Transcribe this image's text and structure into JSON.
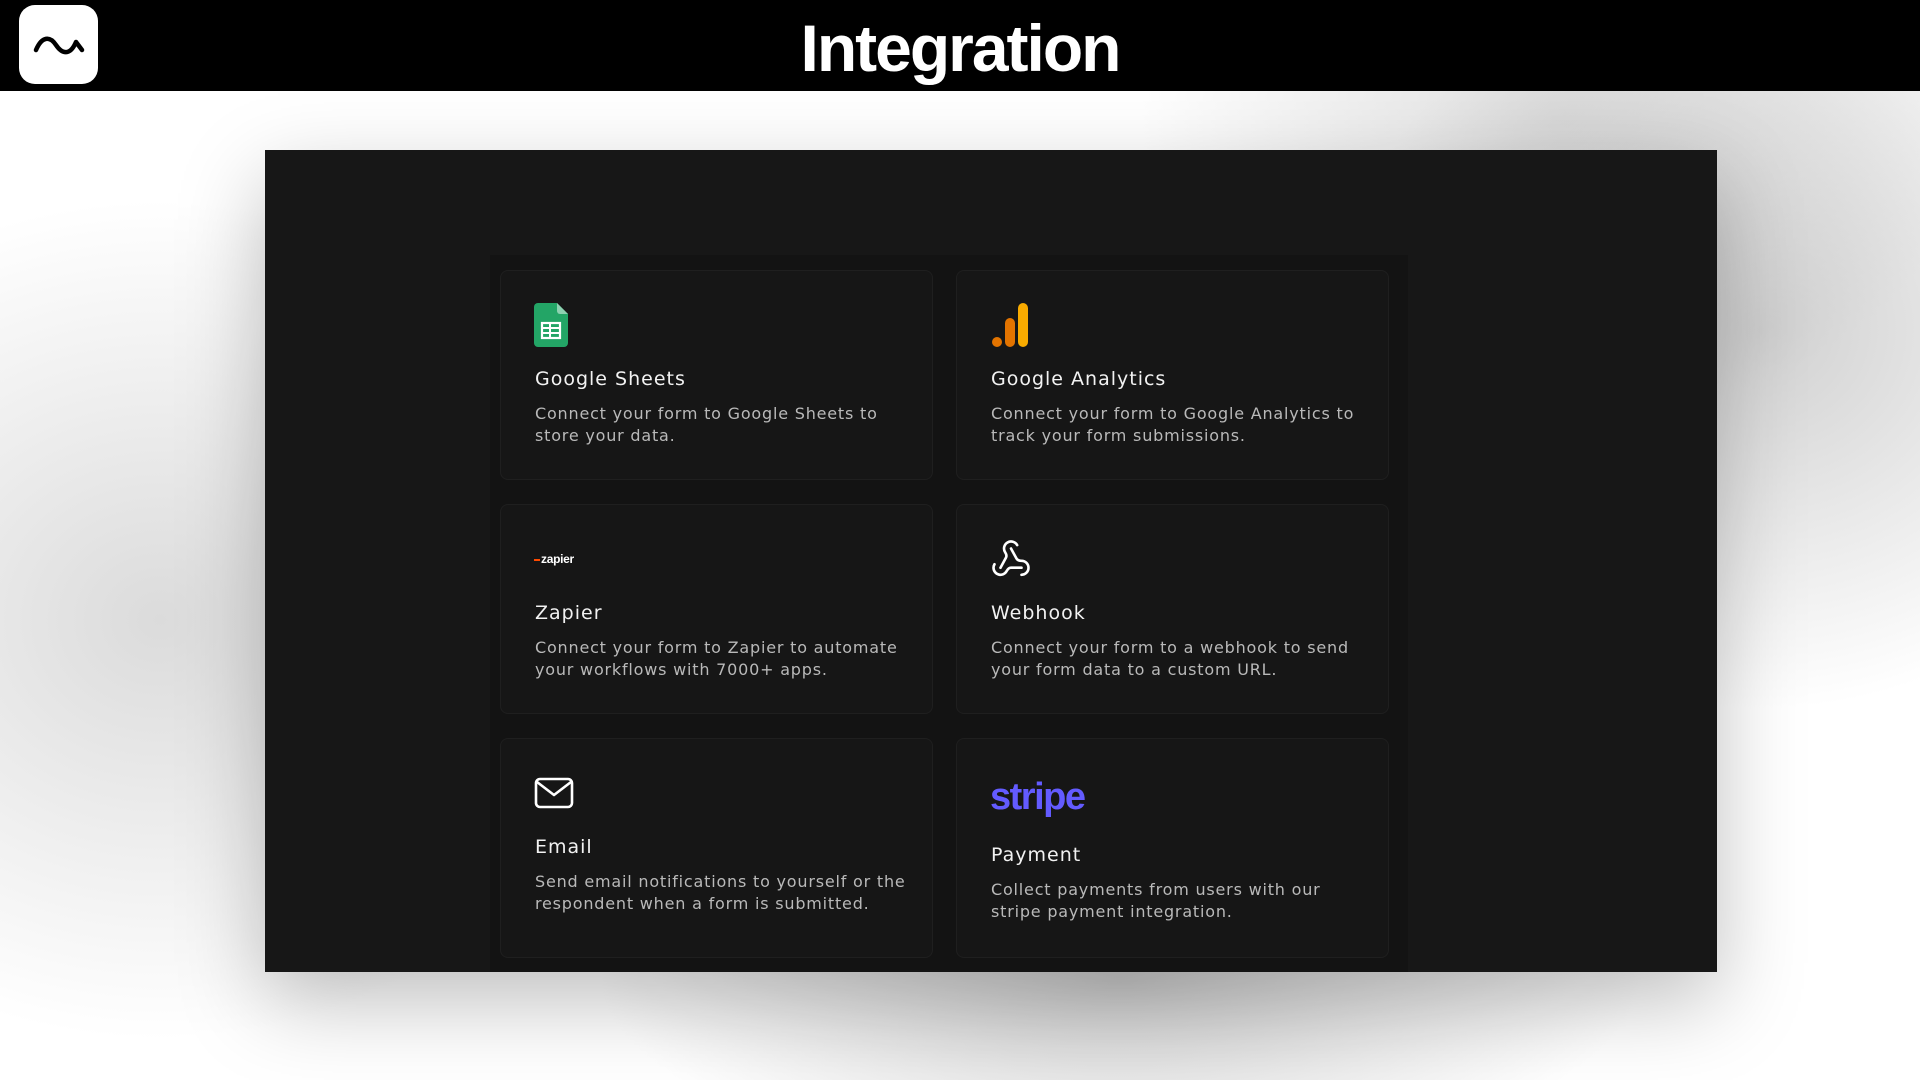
{
  "header": {
    "title": "Integration",
    "logo_icon": "wave-logo-icon"
  },
  "integrations": [
    {
      "title": "Google Sheets",
      "description": "Connect your form to Google Sheets to store your data.",
      "icon": "google-sheets-icon"
    },
    {
      "title": "Google Analytics",
      "description": "Connect your form to Google Analytics to track your form submissions.",
      "icon": "google-analytics-icon"
    },
    {
      "title": "Zapier",
      "description": "Connect your form to Zapier to automate your workflows with 7000+ apps.",
      "icon": "zapier-logo",
      "logo_text": "zapier"
    },
    {
      "title": "Webhook",
      "description": "Connect your form to a webhook to send your form data to a custom URL.",
      "icon": "webhook-icon"
    },
    {
      "title": "Email",
      "description": "Send email notifications to yourself or the respondent when a form is submitted.",
      "icon": "mail-icon"
    },
    {
      "title": "Payment",
      "description": "Collect payments from users with our stripe payment integration.",
      "icon": "stripe-logo",
      "logo_text": "stripe"
    }
  ],
  "colors": {
    "sheets_green": "#23a566",
    "analytics_orange": "#f9ab00",
    "analytics_dark_orange": "#e37400",
    "stripe_purple": "#635bff",
    "zapier_orange": "#ff4a00",
    "window_bg": "#171717",
    "card_bg": "#161616"
  }
}
